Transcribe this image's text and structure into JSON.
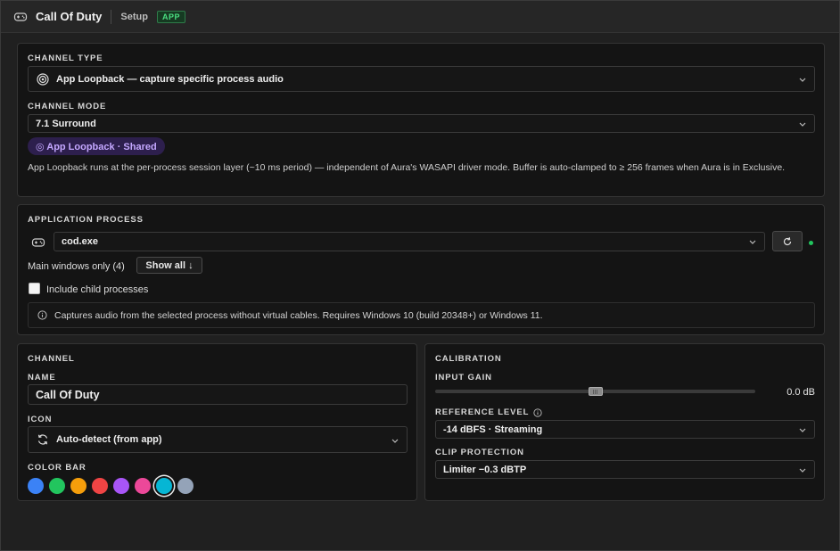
{
  "titlebar": {
    "title": "Call Of Duty",
    "subtitle": "Setup",
    "badge": "APP"
  },
  "channel_type": {
    "label": "CHANNEL TYPE",
    "value": "App Loopback — capture specific process audio",
    "mode_label": "CHANNEL MODE",
    "mode_value": "7.1 Surround",
    "pill": "◎ App Loopback · Shared",
    "description": "App Loopback runs at the per-process session layer (~10 ms period) — independent of Aura's WASAPI driver mode. Buffer is auto-clamped to ≥ 256 frames when Aura is in Exclusive."
  },
  "application_process": {
    "label": "APPLICATION PROCESS",
    "process": "cod.exe",
    "windows_text": "Main windows only (4)",
    "show_all": "Show all ↓",
    "include_child": "Include child processes",
    "include_child_checked": false,
    "info": "Captures audio from the selected process without virtual cables. Requires Windows 10 (build 20348+) or Windows 11.",
    "status_color": "#22c55e"
  },
  "channel": {
    "label": "CHANNEL",
    "name_label": "NAME",
    "name_value": "Call Of Duty",
    "icon_label": "ICON",
    "icon_value": "Auto-detect (from app)",
    "color_bar_label": "COLOR BAR",
    "colors": [
      "#3b82f6",
      "#22c55e",
      "#f59e0b",
      "#ef4444",
      "#a855f7",
      "#ec4899",
      "#06b6d4",
      "#94a3b8"
    ],
    "selected_color_index": 6
  },
  "calibration": {
    "label": "CALIBRATION",
    "input_gain_label": "INPUT GAIN",
    "input_gain_value": "0.0 dB",
    "input_gain_fraction": 0.5,
    "reference_level_label": "REFERENCE LEVEL",
    "reference_level_value": "-14 dBFS · Streaming",
    "clip_protection_label": "CLIP PROTECTION",
    "clip_protection_value": "Limiter −0.3 dBTP"
  }
}
